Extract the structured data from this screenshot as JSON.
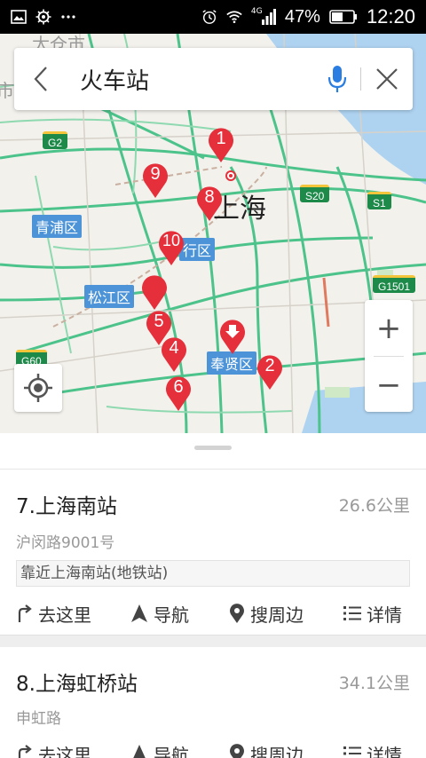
{
  "status_bar": {
    "network": "4G",
    "battery": "47%",
    "time": "12:20"
  },
  "search": {
    "query": "火车站"
  },
  "map": {
    "city_label": "上海",
    "faded_label": "太仓市",
    "edge_label": "市",
    "roads": [
      "G2",
      "S20",
      "S1",
      "G1501",
      "G60"
    ],
    "districts": [
      "青浦区",
      "松江区",
      "行区",
      "奉贤区"
    ],
    "pins": [
      "1",
      "2",
      "4",
      "5",
      "6",
      "7",
      "8",
      "9",
      "10"
    ],
    "zoom_in": "+",
    "zoom_out": "−"
  },
  "results": [
    {
      "title": "7.上海南站",
      "distance": "26.6公里",
      "address": "沪闵路9001号",
      "near": "靠近上海南站(地铁站)"
    },
    {
      "title": "8.上海虹桥站",
      "distance": "34.1公里",
      "address": "申虹路"
    }
  ],
  "actions": {
    "go_here": "去这里",
    "navigate": "导航",
    "nearby": "搜周边",
    "details": "详情"
  },
  "colors": {
    "pin_red": "#e52f3a",
    "mic_blue": "#2a7de1",
    "road_green": "#4cc38a",
    "district_blue": "#4c93d8"
  }
}
